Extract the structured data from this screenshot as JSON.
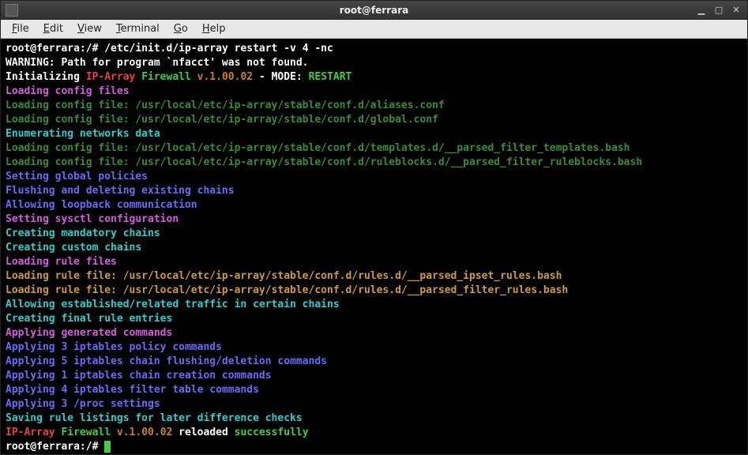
{
  "window": {
    "title": "root@ferrara"
  },
  "menu": {
    "file": "File",
    "edit": "Edit",
    "view": "View",
    "terminal": "Terminal",
    "go": "Go",
    "help": "Help"
  },
  "term": {
    "prompt1": "root@ferrara:/# ",
    "cmd": "/etc/init.d/ip-array restart -v 4 -nc",
    "warn": "WARNING: Path for program `nfacct' was not found.",
    "init1": "Initializing ",
    "init2": "IP-Array ",
    "init3": "Firewall ",
    "init4": "v.1.00.02",
    "init5": " - MODE: ",
    "init6": "RESTART",
    "loadcfg": "Loading config files",
    "cfg1": "Loading config file: /usr/local/etc/ip-array/stable/conf.d/aliases.conf",
    "cfg2": "Loading config file: /usr/local/etc/ip-array/stable/conf.d/global.conf",
    "enum": "Enumerating networks data",
    "cfg3": "Loading config file: /usr/local/etc/ip-array/stable/conf.d/templates.d/__parsed_filter_templates.bash",
    "cfg4": "Loading config file: /usr/local/etc/ip-array/stable/conf.d/ruleblocks.d/__parsed_filter_ruleblocks.bash",
    "setglobal": "Setting global policies",
    "flush": "Flushing and deleting existing chains",
    "loopback": "Allowing loopback communication",
    "sysctl": "Setting sysctl configuration",
    "mand": "Creating mandatory chains",
    "custom": "Creating custom chains",
    "loadrules": "Loading rule files",
    "rule1": "Loading rule file: /usr/local/etc/ip-array/stable/conf.d/rules.d/__parsed_ipset_rules.bash",
    "rule2": "Loading rule file: /usr/local/etc/ip-array/stable/conf.d/rules.d/__parsed_filter_rules.bash",
    "allow": "Allowing established/related traffic in certain chains",
    "final": "Creating final rule entries",
    "apply": "Applying generated commands",
    "apply3p": "Applying 3 iptables policy commands",
    "apply5": "Applying 5 iptables chain flushing/deletion commands",
    "apply1": "Applying 1 iptables chain creation commands",
    "apply4": "Applying 4 iptables filter table commands",
    "apply3s": "Applying 3 /proc settings",
    "saving": "Saving rule listings for later difference checks",
    "done1": "IP-Array ",
    "done2": "Firewall ",
    "done3": "v.1.00.02",
    "done4": " reloaded ",
    "done5": "successfully",
    "prompt2": "root@ferrara:/# "
  }
}
